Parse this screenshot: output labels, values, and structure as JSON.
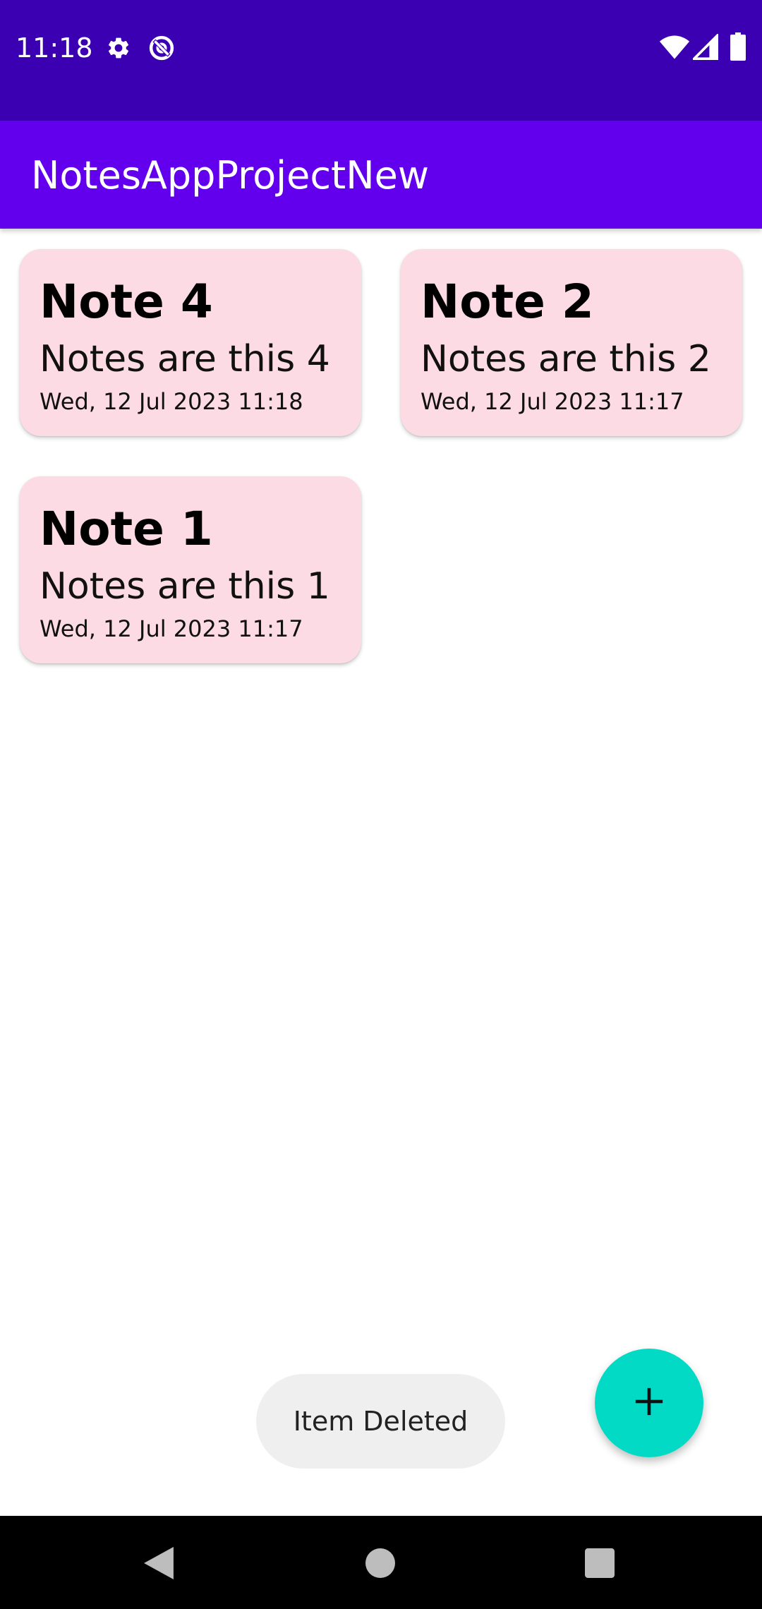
{
  "status_bar": {
    "time": "11:18",
    "icons": [
      "gear-icon",
      "data-saver-icon",
      "wifi-icon",
      "signal-icon",
      "battery-icon"
    ]
  },
  "app_bar": {
    "title": "NotesAppProjectNew"
  },
  "notes": [
    {
      "title": "Note 4",
      "body": "Notes are this 4",
      "date": "Wed, 12 Jul 2023 11:18"
    },
    {
      "title": "Note 2",
      "body": "Notes are this 2",
      "date": "Wed, 12 Jul 2023 11:17"
    },
    {
      "title": "Note 1",
      "body": "Notes are this 1",
      "date": "Wed, 12 Jul 2023 11:17"
    }
  ],
  "toast": {
    "message": "Item Deleted"
  },
  "fab": {
    "icon": "plus-icon"
  },
  "nav_bar": {
    "buttons": [
      "back-icon",
      "home-icon",
      "recents-icon"
    ]
  },
  "colors": {
    "status_bar": "#3c00b3",
    "app_bar": "#6200ee",
    "card": "#fcdbe4",
    "fab": "#03dac5",
    "toast": "#efefef",
    "nav_bar": "#000000"
  }
}
